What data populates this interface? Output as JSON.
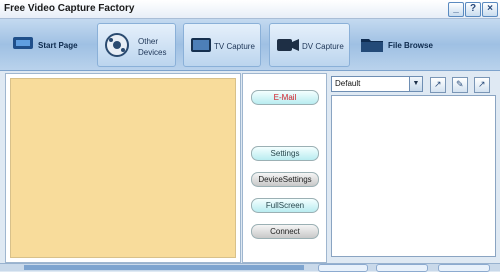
{
  "window": {
    "title": "Free Video Capture Factory"
  },
  "toolbar": {
    "start_page": "Start Page",
    "other_devices_line1": "Other",
    "other_devices_line2": "Devices",
    "tv_capture": "TV Capture",
    "dv_capture": "DV Capture",
    "file_browse": "File Browse"
  },
  "middle": {
    "email": "E-Mail",
    "settings": "Settings",
    "device_settings": "DeviceSettings",
    "fullscreen": "FullScreen",
    "connect": "Connect"
  },
  "right": {
    "profile_selected": "Default"
  },
  "colors": {
    "preview": "#f8dc9b",
    "email_text": "#d0202a"
  }
}
